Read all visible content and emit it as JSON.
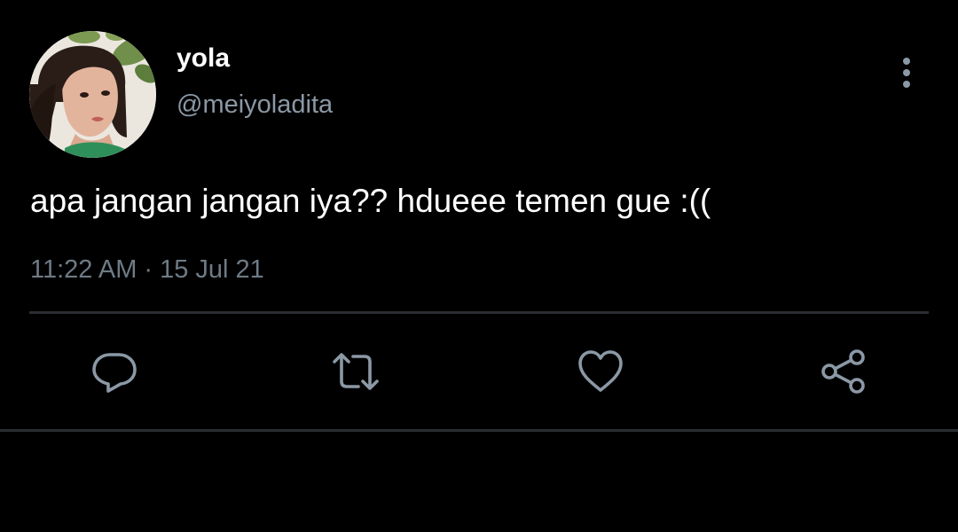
{
  "user": {
    "display_name": "yola",
    "handle": "@meiyoladita"
  },
  "tweet": {
    "text": "apa jangan jangan iya?? hdueee temen gue :((",
    "time": "11:22 AM",
    "separator": "·",
    "date": "15 Jul 21"
  },
  "actions": [
    {
      "icon": "reply-icon"
    },
    {
      "icon": "retweet-icon"
    },
    {
      "icon": "like-icon"
    },
    {
      "icon": "share-icon"
    }
  ],
  "colors": {
    "background": "#000000",
    "primary_text": "#ffffff",
    "secondary_text": "#8b98a5",
    "icon": "#8b98a5",
    "divider": "#2a2d31"
  }
}
